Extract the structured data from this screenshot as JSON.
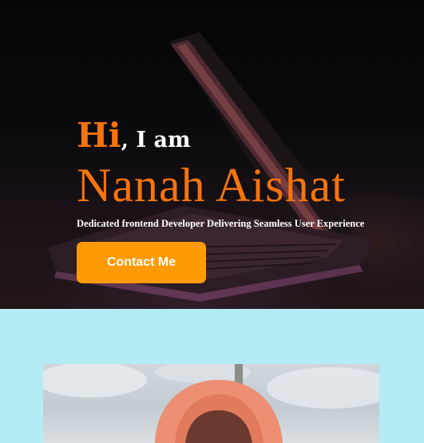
{
  "hero": {
    "greeting_hi": "Hi",
    "greeting_rest": ", I am",
    "name": "Nanah Aishat",
    "tagline": "Dedicated frontend Developer Delivering Seamless User Experience",
    "contact_label": "Contact Me",
    "accent_color": "#f5740d",
    "button_color": "#fe9a04"
  },
  "about": {
    "background_color": "#b3ecf5"
  }
}
